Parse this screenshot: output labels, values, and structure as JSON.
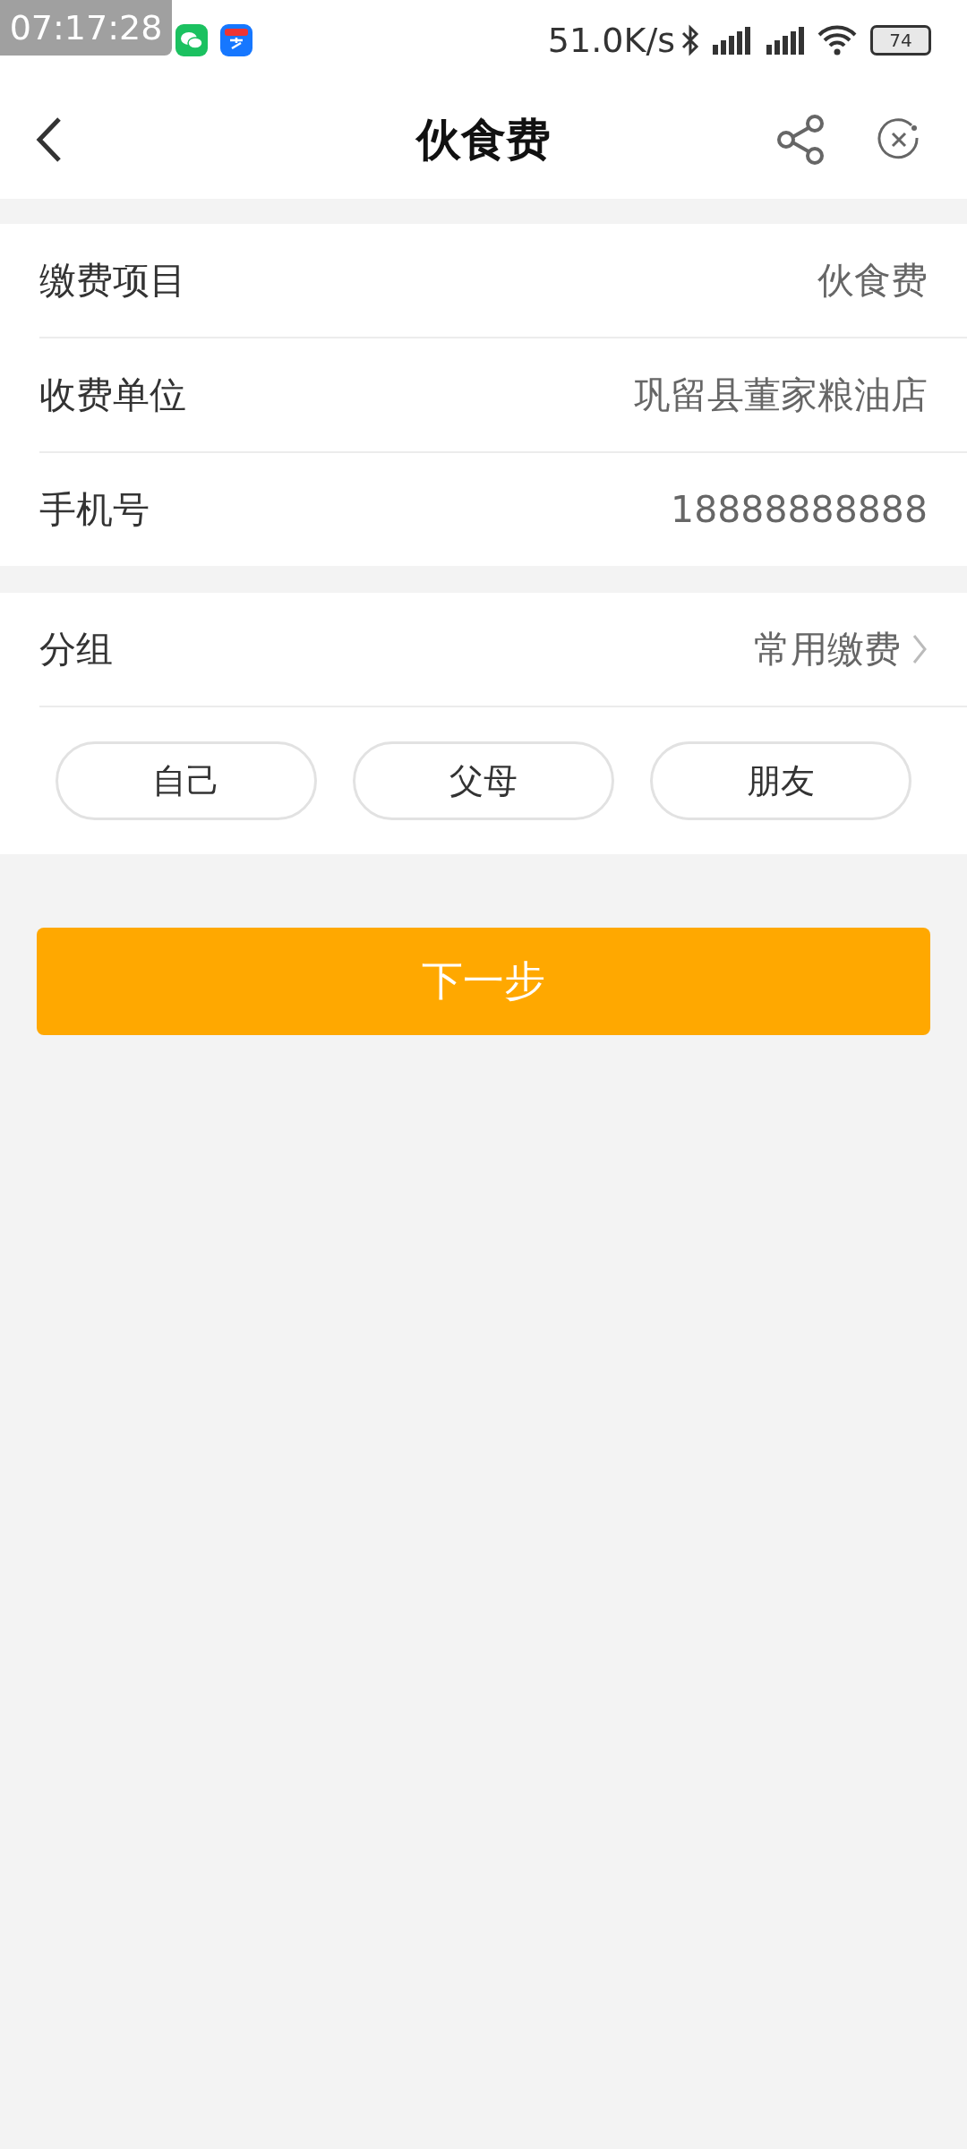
{
  "status_bar": {
    "overlay_time": "07:17:28",
    "network_speed": "51.0K/s",
    "battery": "74"
  },
  "header": {
    "title": "伙食费"
  },
  "info_rows": [
    {
      "label": "缴费项目",
      "value": "伙食费"
    },
    {
      "label": "收费单位",
      "value": "巩留县董家粮油店"
    },
    {
      "label": "手机号",
      "value": "18888888888"
    }
  ],
  "group": {
    "label": "分组",
    "value": "常用缴费"
  },
  "group_chips": [
    {
      "label": "自己"
    },
    {
      "label": "父母"
    },
    {
      "label": "朋友"
    }
  ],
  "next_button": "下一步"
}
